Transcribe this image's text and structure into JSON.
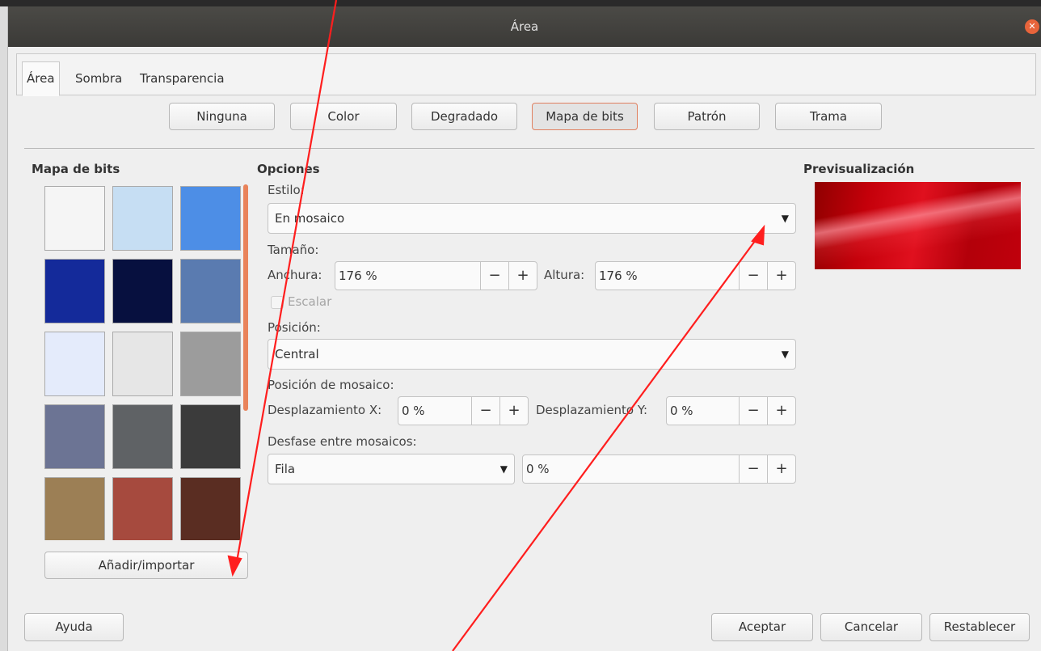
{
  "window": {
    "title": "Área"
  },
  "tabs": [
    {
      "label": "Área",
      "active": true
    },
    {
      "label": "Sombra",
      "active": false
    },
    {
      "label": "Transparencia",
      "active": false
    }
  ],
  "fill_types": [
    {
      "label": "Ninguna",
      "active": false
    },
    {
      "label": "Color",
      "active": false
    },
    {
      "label": "Degradado",
      "active": false
    },
    {
      "label": "Mapa de bits",
      "active": true
    },
    {
      "label": "Patrón",
      "active": false
    },
    {
      "label": "Trama",
      "active": false
    }
  ],
  "bitmap_section": {
    "title": "Mapa de bits",
    "add_button": "Añadir/importar",
    "swatches": [
      {
        "name": "white-bitmap-swatch",
        "color": "#f5f5f5"
      },
      {
        "name": "sky-bitmap-swatch",
        "color": "#c6def3"
      },
      {
        "name": "water-bitmap-swatch",
        "color": "#4d8ee6"
      },
      {
        "name": "blue-grain-bitmap-swatch",
        "color": "#142a9a"
      },
      {
        "name": "night-stars-bitmap-swatch",
        "color": "#07103f"
      },
      {
        "name": "blue-weave-bitmap-swatch",
        "color": "#5a7bb0"
      },
      {
        "name": "droplets-bitmap-swatch",
        "color": "#e4ebfb"
      },
      {
        "name": "white-marble-bitmap-swatch",
        "color": "#e6e6e6"
      },
      {
        "name": "grey-texture-bitmap-swatch",
        "color": "#9c9c9c"
      },
      {
        "name": "grey-stone-bitmap-swatch",
        "color": "#6c7494"
      },
      {
        "name": "chrome-bitmap-swatch",
        "color": "#5f6265"
      },
      {
        "name": "gravel-bitmap-swatch",
        "color": "#3b3b3b"
      },
      {
        "name": "stone-wall-bitmap-swatch",
        "color": "#9c7f55"
      },
      {
        "name": "brick-bitmap-swatch",
        "color": "#a64a3e"
      },
      {
        "name": "wicker-bitmap-swatch",
        "color": "#5a2d22"
      }
    ]
  },
  "options": {
    "title": "Opciones",
    "style_label": "Estilo:",
    "style_value": "En mosaico",
    "size_label": "Tamaño:",
    "width_label": "Anchura:",
    "width_value": "176 %",
    "height_label": "Altura:",
    "height_value": "176 %",
    "scale_label": "Escalar",
    "position_label": "Posición:",
    "position_value": "Central",
    "tile_position_label": "Posición de mosaico:",
    "offset_x_label": "Desplazamiento X:",
    "offset_x_value": "0 %",
    "offset_y_label": "Desplazamiento Y:",
    "offset_y_value": "0 %",
    "tile_offset_label": "Desfase entre mosaicos:",
    "tile_offset_mode": "Fila",
    "tile_offset_value": "0 %",
    "minus": "−",
    "plus": "+",
    "dropdown_glyph": "▼"
  },
  "preview": {
    "title": "Previsualización"
  },
  "footer": {
    "help": "Ayuda",
    "accept": "Aceptar",
    "cancel": "Cancelar",
    "reset": "Restablecer"
  },
  "colors": {
    "annotation_arrow": "#ff1e1e",
    "active_button_border": "#e08060",
    "titlebar": "#3f3e3a"
  }
}
